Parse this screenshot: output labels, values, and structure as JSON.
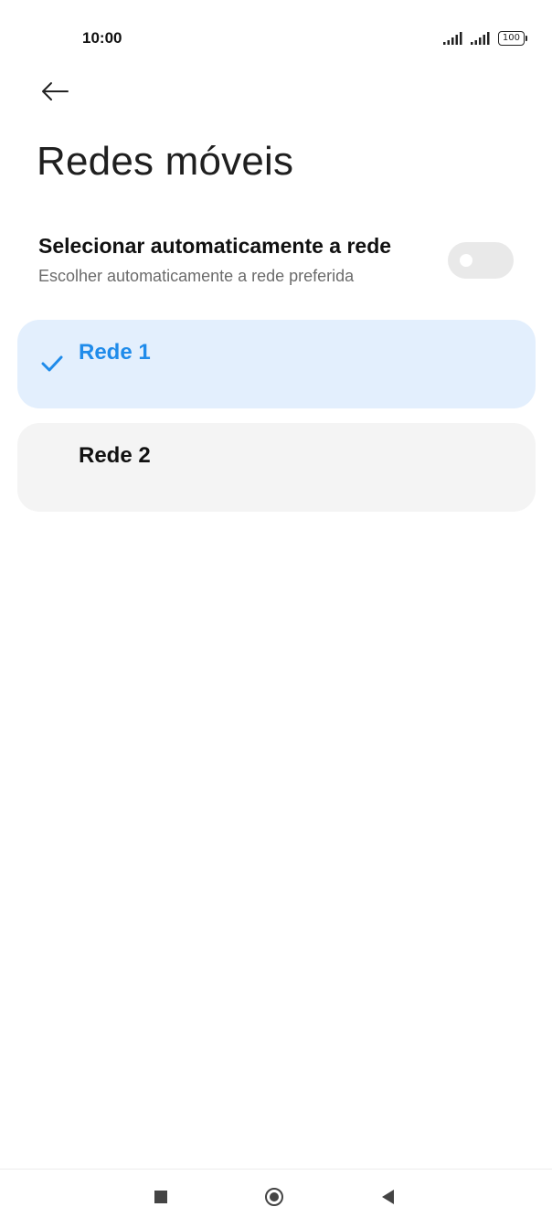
{
  "status_bar": {
    "time": "10:00",
    "battery_level": "100",
    "icons": [
      "signal-icon",
      "signal-icon",
      "battery-icon"
    ]
  },
  "header": {
    "back_icon": "arrow-left-icon",
    "title": "Redes móveis"
  },
  "auto_select": {
    "title": "Selecionar automaticamente a rede",
    "subtitle": "Escolher automaticamente a rede preferida",
    "enabled": false
  },
  "networks": [
    {
      "label": "Rede 1",
      "selected": true,
      "icon": "checkmark-icon"
    },
    {
      "label": "Rede 2",
      "selected": false
    }
  ],
  "nav_bar": {
    "icons": [
      "recents-square-icon",
      "home-circle-icon",
      "back-triangle-icon"
    ]
  },
  "colors": {
    "accent": "#1f8bea",
    "selected_card": "#e3effd",
    "unselected_card": "#f4f4f4",
    "toggle_off": "#e9e9e9"
  }
}
